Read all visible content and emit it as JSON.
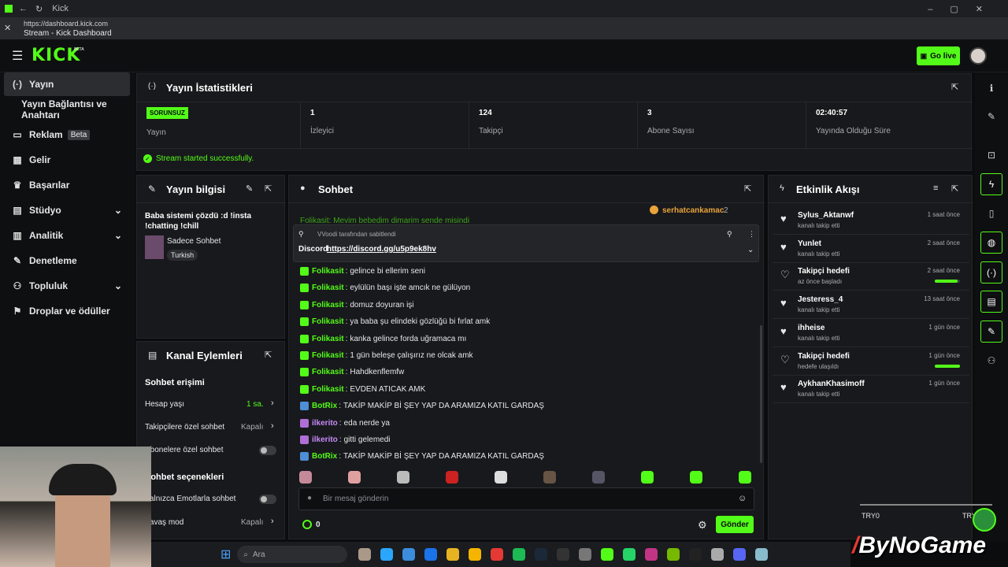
{
  "browser": {
    "tab_title": "Kick",
    "url": "https://dashboard.kick.com",
    "page_title": "Stream - Kick Dashboard"
  },
  "topbar": {
    "logo": "KICK",
    "logo_badge": "BETA",
    "go_live": "Go live"
  },
  "sidebar": {
    "items": [
      {
        "label": "Yayın",
        "icon": "broadcast-icon"
      },
      {
        "label": "Yayın Bağlantısı ve Anahtarı",
        "icon": ""
      },
      {
        "label": "Reklam",
        "icon": "ad-icon",
        "badge": "Beta"
      },
      {
        "label": "Gelir",
        "icon": "income-icon"
      },
      {
        "label": "Başarılar",
        "icon": "trophy-icon"
      },
      {
        "label": "Stüdyo",
        "icon": "studio-icon"
      },
      {
        "label": "Analitik",
        "icon": "analytics-icon"
      },
      {
        "label": "Denetleme",
        "icon": "wrench-icon"
      },
      {
        "label": "Topluluk",
        "icon": "community-icon"
      },
      {
        "label": "Droplar ve ödüller",
        "icon": "gift-icon"
      }
    ]
  },
  "stats": {
    "title": "Yayın İstatistikleri",
    "status_badge": "SORUNSUZ",
    "status_label": "Yayın",
    "cells": [
      {
        "value": "1",
        "label": "İzleyici"
      },
      {
        "value": "124",
        "label": "Takipçi"
      },
      {
        "value": "3",
        "label": "Abone Sayısı"
      },
      {
        "value": "02:40:57",
        "label": "Yayında Olduğu Süre"
      }
    ],
    "success": "Stream started successfully."
  },
  "stream_info": {
    "title": "Yayın bilgisi",
    "stream_title": "Baba sistemi çözdü :d !insta !chatting !chill",
    "category": "Sadece Sohbet",
    "tag": "Turkish"
  },
  "channel_actions": {
    "title": "Kanal Eylemleri",
    "chat_access": "Sohbet erişimi",
    "account_age": "Hesap yaşı",
    "account_age_val": "1 sa.",
    "followers_only": "Takipçilere özel sohbet",
    "followers_only_val": "Kapalı",
    "subs_only": "Abonelere özel sohbet",
    "chat_options": "Sohbet seçenekleri",
    "emote_only": "Yalnızca Emotlarla sohbet",
    "slow_mode": "Yavaş mod",
    "slow_mode_val": "Kapalı"
  },
  "chat": {
    "title": "Sohbet",
    "top_user": "serhatcankamac",
    "top_count": "2",
    "cut_line": "Folikasit: Mevim bebedim dimarim sende misindi",
    "pinned_by": "VVoodi tarafından sabitlendi",
    "pinned_text": "Discord",
    "pinned_link": "https://discord.gg/u5p9ek8hv",
    "messages": [
      {
        "user": "Folikasit",
        "text": "gelince bi ellerim seni"
      },
      {
        "user": "Folikasit",
        "text": "eylülün başı işte amcık ne gülüyon"
      },
      {
        "user": "Folikasit",
        "text": "domuz doyuran işi"
      },
      {
        "user": "Folikasit",
        "text": "ya baba şu elindeki gözlüğü bi fırlat amk"
      },
      {
        "user": "Folikasit",
        "text": "kanka gelince forda uğramaca mı"
      },
      {
        "user": "Folikasit",
        "text": "1 gün beleşe çalışırız ne olcak amk"
      },
      {
        "user": "Folikasit",
        "text": "Hahdkenflemfw"
      },
      {
        "user": "Folikasit",
        "text": "EVDEN ATICAK AMK"
      },
      {
        "user": "BotRix",
        "text": "TAKİP MAKİP Bİ ŞEY YAP DA ARAMIZA KATIL GARDAŞ"
      },
      {
        "user": "ilkerito",
        "text": "eda nerde ya"
      },
      {
        "user": "ilkerito",
        "text": "gitti gelemedi"
      },
      {
        "user": "BotRix",
        "text": "TAKİP MAKİP Bİ ŞEY YAP DA ARAMIZA KATIL GARDAŞ"
      }
    ],
    "input_placeholder": "Bir mesaj gönderin",
    "points": "0",
    "send": "Gönder"
  },
  "activity": {
    "title": "Etkinlik Akışı",
    "items": [
      {
        "name": "Sylus_Aktanwf",
        "sub": "kanalı takip etti",
        "time": "1 saat önce",
        "type": "follow"
      },
      {
        "name": "Yunlet",
        "sub": "kanalı takip etti",
        "time": "2 saat önce",
        "type": "follow"
      },
      {
        "name": "Takipçi hedefi",
        "sub": "az önce başladı",
        "time": "2 saat önce",
        "type": "goal",
        "progress": 0.9
      },
      {
        "name": "Jesteress_4",
        "sub": "kanalı takip etti",
        "time": "13 saat önce",
        "type": "follow"
      },
      {
        "name": "ihheise",
        "sub": "kanalı takip etti",
        "time": "1 gün önce",
        "type": "follow"
      },
      {
        "name": "Takipçi hedefi",
        "sub": "hedefe ulaşıldı",
        "time": "1 gün önce",
        "type": "goal",
        "progress": 1.0
      },
      {
        "name": "AykhanKhasimoff",
        "sub": "kanalı takip etti",
        "time": "1 gün önce",
        "type": "follow"
      }
    ]
  },
  "overlay": {
    "ticker_left": "TRY0",
    "ticker_right": "TRY0",
    "watermark": "ByNoGame",
    "taskbar_search": "Ara"
  },
  "colors": {
    "accent": "#53fc18",
    "panel": "#18191c",
    "bg": "#0b0c0d"
  }
}
